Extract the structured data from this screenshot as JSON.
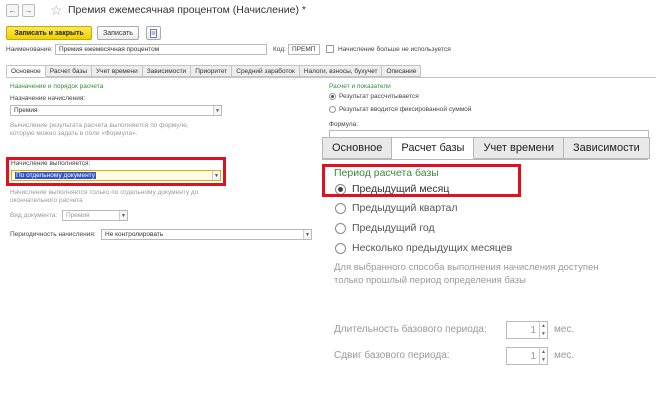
{
  "window": {
    "back_glyph": "←",
    "forward_glyph": "→",
    "star_glyph": "☆",
    "title": "Премия ежемесячная процентом (Начисление) *"
  },
  "toolbar": {
    "save_close_label": "Записать и закрыть",
    "save_label": "Записать"
  },
  "header": {
    "name_label": "Наименование:",
    "name_value": "Премия ежемесячная процентом",
    "code_label": "Код:",
    "code_value": "ПРЕМП",
    "not_used_label": "Начисление больше не используется"
  },
  "tabs_small": [
    "Основное",
    "Расчет базы",
    "Учет времени",
    "Зависимости",
    "Приоритет",
    "Средний заработок",
    "Налоги, взносы, бухучет",
    "Описание"
  ],
  "left": {
    "section_title": "Назначение и порядок расчета",
    "purpose_label": "Назначение начисления:",
    "purpose_value": "Премия",
    "formula_hint_1": "Вычисление результата расчета выполняется по формуле,",
    "formula_hint_2": "которую можно задать в поле «Формула».",
    "exec_label": "Начисление выполняется:",
    "exec_value": "По отдельному документу",
    "exec_hint_1": "Начисление выполняется только по отдельному документу до",
    "exec_hint_2": "окончательного расчета",
    "doc_type_label": "Вид документа:",
    "doc_type_value": "Премия",
    "periodicity_label": "Периодичность начисления:",
    "periodicity_value": "Не контролировать"
  },
  "right": {
    "section_title": "Расчет и показатели",
    "radio_1": "Результат рассчитывается",
    "radio_2": "Результат вводится фиксированной суммой",
    "formula_label": "Формула:"
  },
  "zoom": {
    "tabs": [
      "Основное",
      "Расчет базы",
      "Учет времени",
      "Зависимости"
    ],
    "period_title": "Период расчета базы",
    "options": [
      "Предыдущий месяц",
      "Предыдущий квартал",
      "Предыдущий год",
      "Несколько предыдущих месяцев"
    ],
    "note_1": "Для выбранного способа выполнения начисления доступен",
    "note_2": "только прошлый период определения базы",
    "duration_label": "Длительность базового периода:",
    "duration_value": "1",
    "shift_label": "Сдвиг базового периода:",
    "shift_value": "1",
    "unit": "мес."
  },
  "colors": {
    "highlight": "#e01020",
    "accent_green": "#3a8a3a",
    "primary_button": "#f0d200"
  }
}
